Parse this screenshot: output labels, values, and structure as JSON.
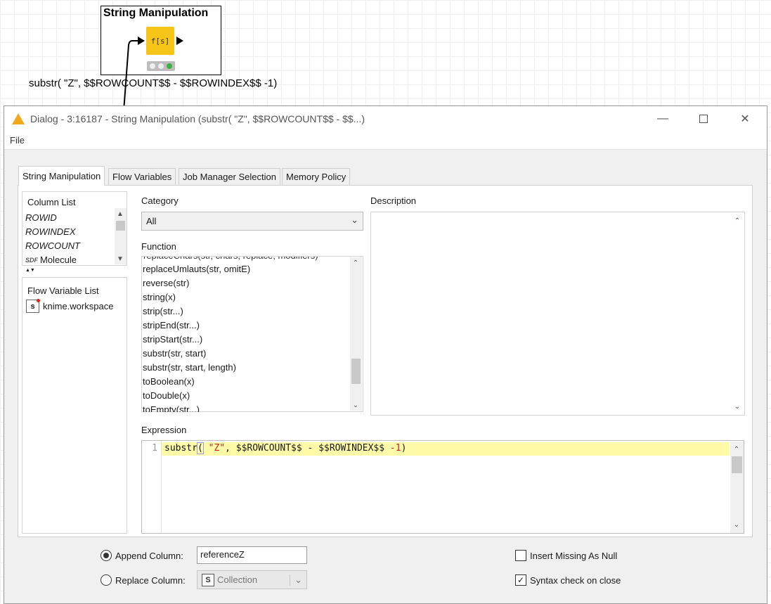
{
  "workflow": {
    "node_title": "String Manipulation",
    "node_icon_text": "f[s]",
    "node_label": "substr( \"Z\", $$ROWCOUNT$$ - $$ROWINDEX$$ -1)"
  },
  "dialog": {
    "title": "Dialog - 3:16187 - String Manipulation (substr( \"Z\", $$ROWCOUNT$$ - $$...)",
    "menu": {
      "file": "File"
    },
    "tabs": [
      {
        "label": "String Manipulation",
        "active": true
      },
      {
        "label": "Flow Variables",
        "active": false
      },
      {
        "label": "Job Manager Selection",
        "active": false
      },
      {
        "label": "Memory Policy",
        "active": false
      }
    ],
    "column_list": {
      "header": "Column List",
      "items": [
        "ROWID",
        "ROWINDEX",
        "ROWCOUNT",
        "Molecule"
      ],
      "molecule_type_badge": "SDF"
    },
    "flow_variable_list": {
      "header": "Flow Variable List",
      "items": [
        "knime.workspace"
      ],
      "type_badge": "s"
    },
    "category": {
      "label": "Category",
      "selected": "All"
    },
    "function": {
      "label": "Function",
      "items": [
        "replaceUmlauts(str, omitE)",
        "reverse(str)",
        "string(x)",
        "strip(str...)",
        "stripEnd(str...)",
        "stripStart(str...)",
        "substr(str, start)",
        "substr(str, start, length)",
        "toBoolean(x)",
        "toDouble(x)",
        "toEmpty(str...)"
      ]
    },
    "description": {
      "label": "Description"
    },
    "expression": {
      "label": "Expression",
      "line_number": "1",
      "code_fn": "substr",
      "code_paren": "(",
      "code_str": "\"Z\"",
      "code_mid": ", $$ROWCOUNT$$ - $$ROWINDEX$$ ",
      "code_num": "-1",
      "code_close": ")"
    },
    "options": {
      "append_label": "Append Column:",
      "append_value": "referenceZ",
      "append_selected": true,
      "replace_label": "Replace Column:",
      "replace_value": "Collection",
      "replace_badge": "S",
      "insert_missing_label": "Insert Missing As Null",
      "insert_missing_checked": false,
      "syntax_check_label": "Syntax check on close",
      "syntax_check_checked": true
    }
  }
}
